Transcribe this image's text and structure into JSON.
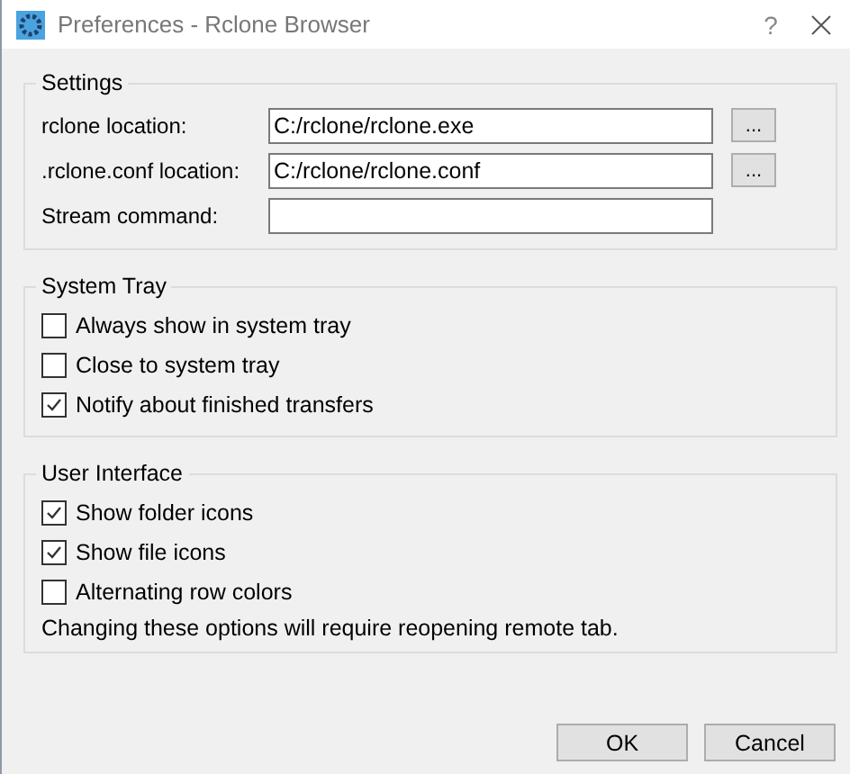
{
  "window": {
    "title": "Preferences - Rclone Browser",
    "help": "?"
  },
  "groups": [
    {
      "title": "Settings",
      "items": [
        {
          "kind": "field",
          "label": "rclone location:",
          "value": "C:/rclone/rclone.exe",
          "browse": "..."
        },
        {
          "kind": "field",
          "label": ".rclone.conf location:",
          "value": "C:/rclone/rclone.conf",
          "browse": "..."
        },
        {
          "kind": "field",
          "label": "Stream command:"
        }
      ]
    },
    {
      "title": "System Tray",
      "items": [
        {
          "kind": "checkbox",
          "label": "Always show in system tray",
          "checked": false
        },
        {
          "kind": "checkbox",
          "label": "Close to system tray",
          "checked": false
        },
        {
          "kind": "checkbox",
          "label": "Notify about finished transfers",
          "checked": true
        }
      ]
    },
    {
      "title": "User Interface",
      "items": [
        {
          "kind": "checkbox",
          "label": "Show folder icons",
          "checked": true
        },
        {
          "kind": "checkbox",
          "label": "Show file icons",
          "checked": true
        },
        {
          "kind": "checkbox",
          "label": "Alternating row colors",
          "checked": false
        },
        {
          "kind": "note",
          "text": "Changing these options will require reopening remote tab."
        }
      ]
    }
  ],
  "buttons": [
    "OK",
    "Cancel"
  ]
}
